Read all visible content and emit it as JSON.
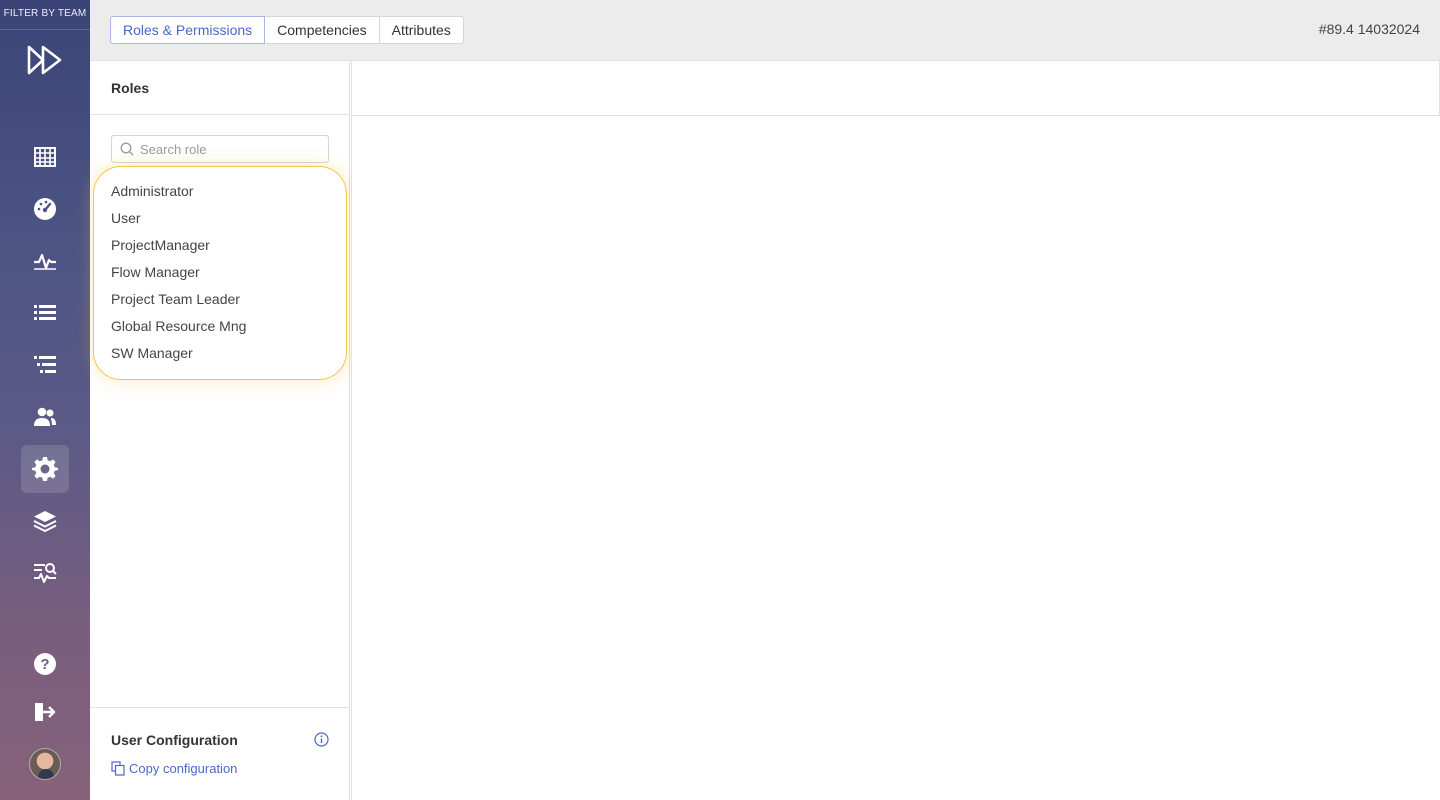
{
  "rail": {
    "filter_label": "FILTER BY TEAM",
    "icons": [
      "planner-grid-icon",
      "dashboard-gauge-icon",
      "activity-pulse-icon",
      "list-icon",
      "tree-list-icon",
      "users-icon",
      "settings-gear-icon",
      "layers-icon",
      "analytics-search-icon",
      "help-icon",
      "logout-icon"
    ],
    "active": "settings-gear-icon"
  },
  "tabs": [
    {
      "label": "Roles & Permissions",
      "active": true
    },
    {
      "label": "Competencies",
      "active": false
    },
    {
      "label": "Attributes",
      "active": false
    }
  ],
  "version": "#89.4 14032024",
  "roles": {
    "title": "Roles",
    "search_placeholder": "Search role",
    "items": [
      "Administrator",
      "User",
      "ProjectManager",
      "Flow Manager",
      "Project Team Leader",
      "Global Resource Mng",
      "SW Manager"
    ]
  },
  "user_config": {
    "title": "User Configuration",
    "copy_label": "Copy configuration"
  },
  "colors": {
    "accent": "#4a68c8",
    "highlight": "#f3c64b"
  }
}
